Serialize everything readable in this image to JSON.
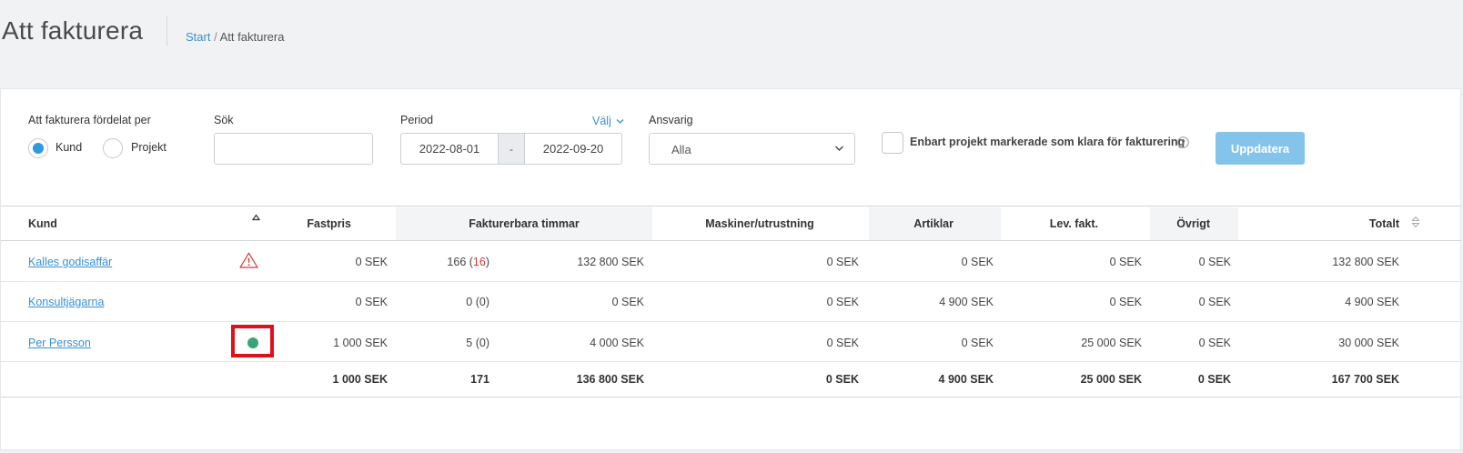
{
  "header": {
    "title": "Att fakturera",
    "breadcrumb_home": "Start",
    "breadcrumb_sep": "/",
    "breadcrumb_current": "Att fakturera"
  },
  "filters": {
    "distribution_label": "Att fakturera fördelat per",
    "radio_customer": "Kund",
    "radio_project": "Projekt",
    "radio_selected": "Kund",
    "search_label": "Sök",
    "search_value": "",
    "period_label": "Period",
    "period_choose": "Välj",
    "period_from": "2022-08-01",
    "period_sep": "-",
    "period_to": "2022-09-20",
    "responsible_label": "Ansvarig",
    "responsible_value": "Alla",
    "only_ready_label": "Enbart projekt markerade som klara för fakturering",
    "only_ready_checked": false,
    "update_button": "Uppdatera"
  },
  "table": {
    "headers": {
      "customer": "Kund",
      "fixed_price": "Fastpris",
      "billable_hours": "Fakturerbara timmar",
      "machines": "Maskiner/utrustning",
      "articles": "Artiklar",
      "supplier_invoices": "Lev. fakt.",
      "other": "Övrigt",
      "total": "Totalt"
    },
    "rows": [
      {
        "customer": "Kalles godisaffär",
        "status": "warning-icon",
        "fixed_price": "0 SEK",
        "hours": "166",
        "hours_extra": "16",
        "hours_amount": "132 800 SEK",
        "machines": "0 SEK",
        "articles": "0 SEK",
        "supplier_invoices": "0 SEK",
        "other": "0 SEK",
        "total": "132 800 SEK"
      },
      {
        "customer": "Konsultjägarna",
        "status": "",
        "fixed_price": "0 SEK",
        "hours": "0",
        "hours_extra": "0",
        "hours_amount": "0 SEK",
        "machines": "0 SEK",
        "articles": "4 900 SEK",
        "supplier_invoices": "0 SEK",
        "other": "0 SEK",
        "total": "4 900 SEK"
      },
      {
        "customer": "Per Persson",
        "status": "green-status-dot",
        "fixed_price": "1 000 SEK",
        "hours": "5",
        "hours_extra": "0",
        "hours_amount": "4 000 SEK",
        "machines": "0 SEK",
        "articles": "0 SEK",
        "supplier_invoices": "25 000 SEK",
        "other": "0 SEK",
        "total": "30 000 SEK"
      }
    ],
    "totals": {
      "fixed_price": "1 000 SEK",
      "hours": "171",
      "hours_amount": "136 800 SEK",
      "machines": "0 SEK",
      "articles": "4 900 SEK",
      "supplier_invoices": "25 000 SEK",
      "other": "0 SEK",
      "total": "167 700 SEK"
    }
  },
  "colors": {
    "accent": "#2d9ae0",
    "link": "#3a8fd4",
    "button": "#85c4ea",
    "warning": "#d23a3a",
    "status_ok": "#3aa37a",
    "highlight": "#e0101a"
  }
}
